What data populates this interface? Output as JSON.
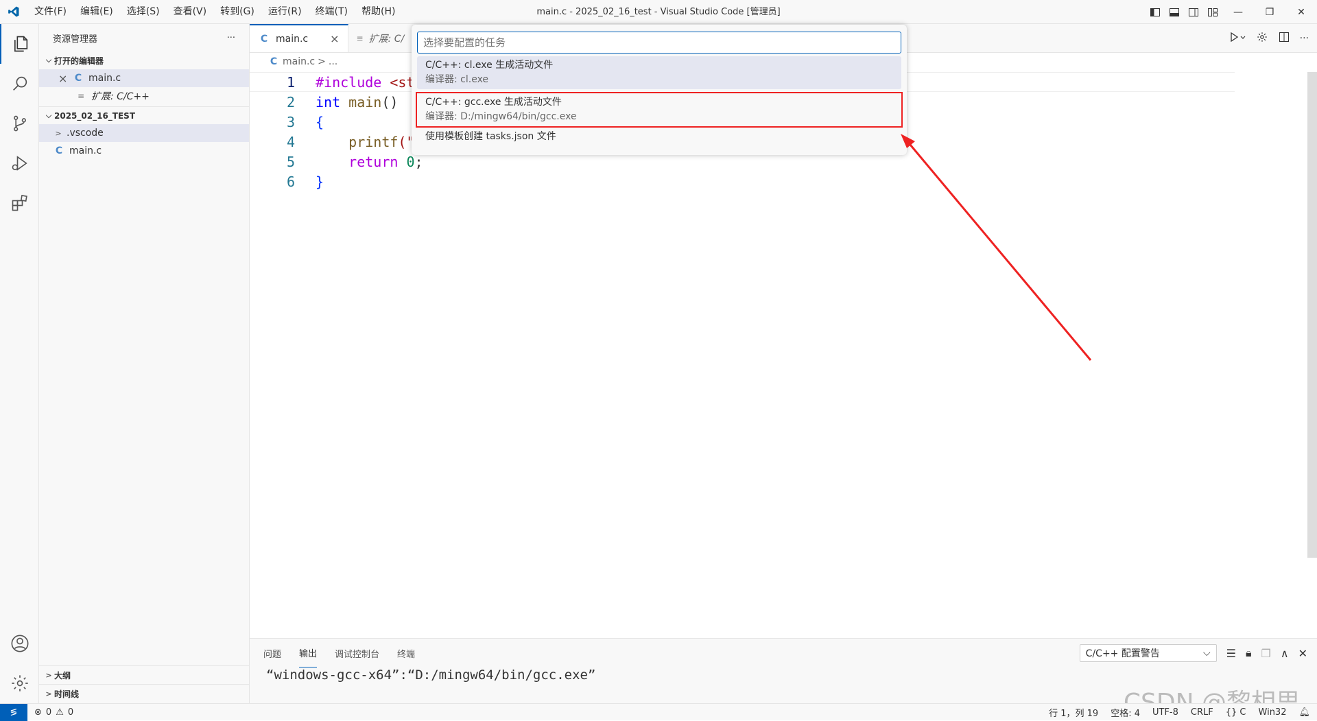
{
  "titlebar": {
    "title": "main.c - 2025_02_16_test - Visual Studio Code [管理员]",
    "menu": [
      "文件(F)",
      "编辑(E)",
      "选择(S)",
      "查看(V)",
      "转到(G)",
      "运行(R)",
      "终端(T)",
      "帮助(H)"
    ]
  },
  "sidebar": {
    "header": "资源管理器",
    "more": "···",
    "open_editors_title": "打开的编辑器",
    "open_editors": [
      {
        "close": "×",
        "icon": "C",
        "label": "main.c"
      },
      {
        "icon": "≡",
        "label": "扩展: C/C++"
      }
    ],
    "folder_title": "2025_02_16_TEST",
    "folder_items": [
      {
        "chevron": ">",
        "label": ".vscode"
      },
      {
        "icon": "C",
        "label": "main.c"
      }
    ],
    "outline_title": "大纲",
    "timeline_title": "时间线"
  },
  "editor": {
    "tabs": [
      {
        "icon": "C",
        "label": "main.c",
        "close": "×"
      },
      {
        "icon": "≡",
        "label": "扩展: C/"
      }
    ],
    "breadcrumb": {
      "icon": "C",
      "file": "main.c",
      "sep": ">",
      "rest": "..."
    },
    "lines": [
      {
        "num": "1"
      },
      {
        "num": "2"
      },
      {
        "num": "3"
      },
      {
        "num": "4"
      },
      {
        "num": "5"
      },
      {
        "num": "6"
      }
    ],
    "code": {
      "l1_pp": "#include",
      "l1_rest": " <st",
      "l2_kw": "int",
      "l2_fn": " main",
      "l2_rest": "()",
      "l3": "{",
      "l4_fn": "    printf",
      "l4_rest": "(\"",
      "l5_kw": "    return",
      "l5_num": " 0",
      "l5_rest": ";",
      "l6": "}"
    }
  },
  "quickpick": {
    "placeholder": "选择要配置的任务",
    "items": [
      {
        "label": "C/C++: cl.exe 生成活动文件",
        "desc": "编译器: cl.exe"
      },
      {
        "label": "C/C++: gcc.exe 生成活动文件",
        "desc": "编译器: D:/mingw64/bin/gcc.exe"
      },
      {
        "label": "使用模板创建 tasks.json 文件"
      }
    ]
  },
  "panel": {
    "tabs": [
      "问题",
      "输出",
      "调试控制台",
      "终端"
    ],
    "active_tab": "输出",
    "select": "C/C++ 配置警告",
    "output": "“windows-gcc-x64”:“D:/mingw64/bin/gcc.exe”"
  },
  "statusbar": {
    "errors": "0",
    "warnings": "0",
    "position": "行 1，列 19",
    "spaces": "空格: 4",
    "encoding": "UTF-8",
    "eol": "CRLF",
    "language": "{} C",
    "platform": "Win32"
  },
  "watermark": "CSDN @黎相思",
  "colors": {
    "accent": "#005fb8",
    "highlight": "#ee2222"
  }
}
